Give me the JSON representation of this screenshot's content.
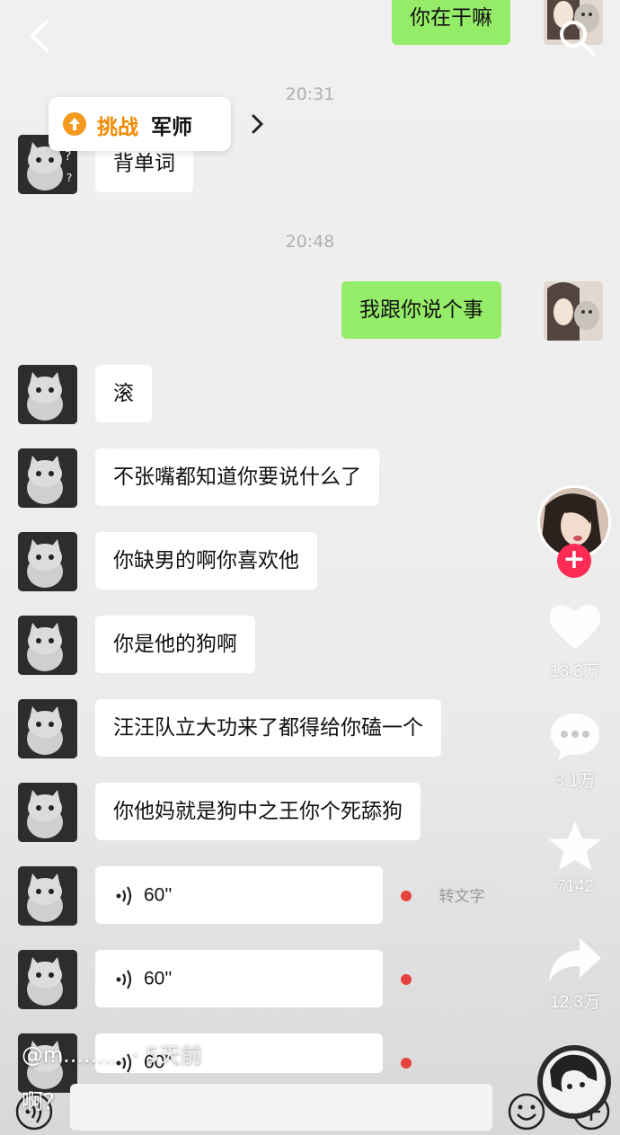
{
  "chat": {
    "timestamps": [
      "20:31",
      "20:48"
    ],
    "messages": {
      "right_top": "你在干嘛",
      "left_1": "背单词",
      "right_2": "我跟你说个事",
      "left_3": "滚",
      "left_4": "不张嘴都知道你要说什么了",
      "left_5": "你缺男的啊你喜欢他",
      "left_6": "你是他的狗啊",
      "left_7": "汪汪队立大功来了都得给你磕一个",
      "left_8": "你他妈就是狗中之王你个死舔狗"
    },
    "voice_messages": [
      {
        "duration": "60''"
      },
      {
        "duration": "60''"
      },
      {
        "duration": "60''"
      }
    ],
    "voice_to_text_label": "转文字"
  },
  "challenge_banner": {
    "label_challenge": "挑战",
    "label_name": "军师"
  },
  "side_actions": {
    "likes": "13.3万",
    "comments": "3.1万",
    "favorites": "7142",
    "shares": "12.3万"
  },
  "overlay": {
    "username": "@ꭑ.........",
    "posted_time": "· 5天前",
    "caption": "啊？"
  },
  "colors": {
    "accent_green": "#95ec69",
    "follow_red": "#fe2c55",
    "unread_dot": "#e64340",
    "challenge_orange": "#f08a00"
  },
  "icons": [
    "back-icon",
    "search-icon",
    "heart-icon",
    "comment-icon",
    "star-icon",
    "share-icon",
    "voice-wave-icon",
    "emoji-icon",
    "plus-icon"
  ]
}
